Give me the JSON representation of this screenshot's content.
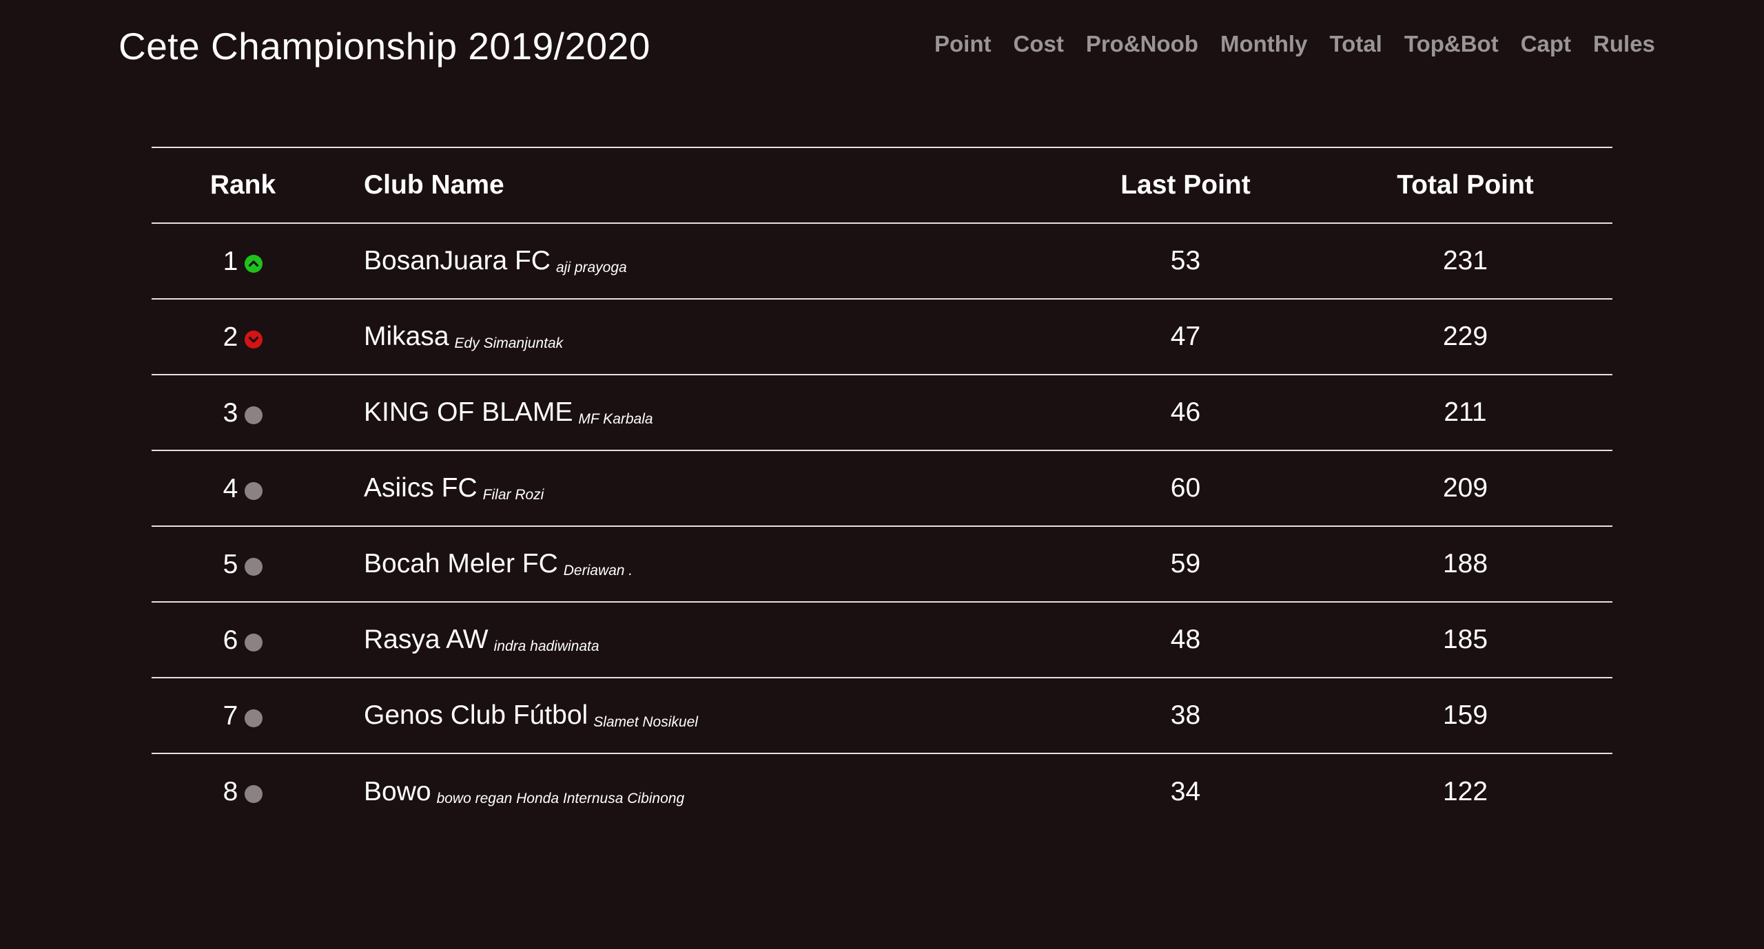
{
  "header": {
    "title": "Cete Championship 2019/2020"
  },
  "nav": [
    "Point",
    "Cost",
    "Pro&Noob",
    "Monthly",
    "Total",
    "Top&Bot",
    "Capt",
    "Rules"
  ],
  "table": {
    "columns": [
      "Rank",
      "Club Name",
      "Last Point",
      "Total Point"
    ],
    "rows": [
      {
        "rank": "1",
        "trend": "up",
        "club": "BosanJuara FC",
        "manager": "aji prayoga",
        "last_point": "53",
        "total_point": "231"
      },
      {
        "rank": "2",
        "trend": "down",
        "club": "Mikasa",
        "manager": "Edy Simanjuntak",
        "last_point": "47",
        "total_point": "229"
      },
      {
        "rank": "3",
        "trend": "same",
        "club": "KING OF BLAME",
        "manager": "MF Karbala",
        "last_point": "46",
        "total_point": "211"
      },
      {
        "rank": "4",
        "trend": "same",
        "club": "Asiics FC",
        "manager": "Filar Rozi",
        "last_point": "60",
        "total_point": "209"
      },
      {
        "rank": "5",
        "trend": "same",
        "club": "Bocah Meler FC",
        "manager": "Deriawan .",
        "last_point": "59",
        "total_point": "188"
      },
      {
        "rank": "6",
        "trend": "same",
        "club": "Rasya AW",
        "manager": "indra hadiwinata",
        "last_point": "48",
        "total_point": "185"
      },
      {
        "rank": "7",
        "trend": "same",
        "club": "Genos Club Fútbol",
        "manager": "Slamet Nosikuel",
        "last_point": "38",
        "total_point": "159"
      },
      {
        "rank": "8",
        "trend": "same",
        "club": "Bowo",
        "manager": "bowo regan Honda Internusa Cibinong",
        "last_point": "34",
        "total_point": "122"
      }
    ]
  },
  "colors": {
    "background": "#1a1011",
    "nav_text": "#9a9596",
    "trend_up": "#1ec21e",
    "trend_down": "#d41414",
    "trend_same": "#8b8283"
  },
  "icons": {
    "up": "chevron-up-circle-icon",
    "down": "chevron-down-circle-icon",
    "same": "dot-icon"
  }
}
